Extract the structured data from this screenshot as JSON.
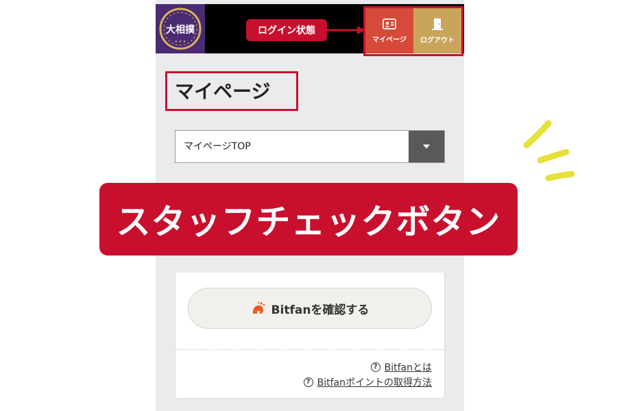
{
  "header": {
    "logo_text": "大相撲",
    "login_state_label": "ログイン状態",
    "mypage_label": "マイページ",
    "logout_label": "ログアウト",
    "icons": {
      "mypage": "id-card-icon",
      "logout": "door-icon"
    }
  },
  "main": {
    "page_title": "マイページ",
    "select": {
      "value": "マイページTOP"
    },
    "bitfan_button_label": "Bitfanを確認する",
    "help_links": [
      "Bitfanとは",
      "Bitfanポイントの取得方法"
    ]
  },
  "banner": {
    "text": "スタッフチェックボタン"
  },
  "colors": {
    "accent_red": "#c8102e",
    "mypage_btn": "#d64a3a",
    "logout_btn": "#c9a55b",
    "logo_bg": "#4a2a72",
    "sparkle": "#e6e03a",
    "bitfan_orange": "#f05a22"
  }
}
